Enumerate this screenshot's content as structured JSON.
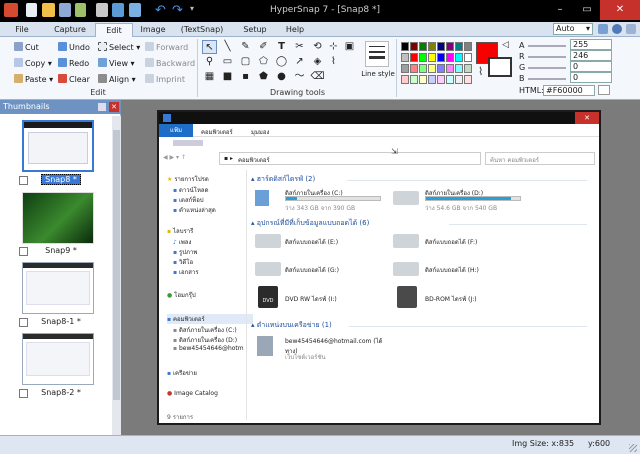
{
  "window": {
    "title": "HyperSnap 7 - [Snap8 *]",
    "minimize": "–",
    "maximize": "▭",
    "close": "✕"
  },
  "tabs": [
    {
      "label": "File",
      "active": false
    },
    {
      "label": "Capture",
      "active": false
    },
    {
      "label": "Edit",
      "active": true
    },
    {
      "label": "Image",
      "active": false
    },
    {
      "label": "(TextSnap)",
      "active": false
    },
    {
      "label": "Setup",
      "active": false
    },
    {
      "label": "Help",
      "active": false
    }
  ],
  "zoom": {
    "value": "Auto",
    "arrow": "▾"
  },
  "ribbon": {
    "edit_group": "Edit",
    "drawing_group": "Drawing tools",
    "buttons": {
      "cut": "Cut",
      "copy": "Copy",
      "paste": "Paste",
      "undo": "Undo",
      "redo": "Redo",
      "clear": "Clear",
      "select": "Select",
      "view": "View",
      "align": "Align",
      "forward": "Forward",
      "backward": "Backward",
      "imprint": "Imprint"
    },
    "line_style": "Line style",
    "color": {
      "a_label": "A",
      "r_label": "R",
      "g_label": "G",
      "b_label": "B",
      "a": "255",
      "r": "246",
      "g": "0",
      "b": "0",
      "html_label": "HTML:",
      "html": "#F60000",
      "current_color": "#F60000"
    },
    "palette": [
      "#000000",
      "#800000",
      "#008000",
      "#808000",
      "#000080",
      "#800080",
      "#008080",
      "#808080",
      "#c0c0c0",
      "#ff0000",
      "#00ff00",
      "#ffff00",
      "#0000ff",
      "#ff00ff",
      "#00ffff",
      "#ffffff",
      "#a0a0a4",
      "#ff8080",
      "#80ff80",
      "#ffff80",
      "#8080ff",
      "#ff80ff",
      "#80ffff",
      "#c0dcc0",
      "#ffcccc",
      "#ccffcc",
      "#ffffcc",
      "#ccccff",
      "#ffccff",
      "#ccffff",
      "#f0f0f0",
      "#ffe0e0"
    ]
  },
  "thumbnails": {
    "header": "Thumbnails",
    "items": [
      {
        "label": "Snap8 *",
        "selected": true
      },
      {
        "label": "Snap9 *",
        "selected": false
      },
      {
        "label": "Snap8-1 *",
        "selected": false
      },
      {
        "label": "Snap8-2 *",
        "selected": false
      }
    ]
  },
  "explorer": {
    "ribbon_tabs": [
      "แฟ้ม",
      "คอมพิวเตอร์",
      "มุมมอง"
    ],
    "breadcrumb": "คอมพิวเตอร์",
    "search_placeholder": "ค้นหา คอมพิวเตอร์",
    "nav": [
      {
        "label": "รายการโปรด"
      },
      {
        "label": "ดาวน์โหลด"
      },
      {
        "label": "เดสก์ท็อป"
      },
      {
        "label": "ตำแหน่งล่าสุด"
      },
      {
        "label": "ไลบรารี"
      },
      {
        "label": "เพลง"
      },
      {
        "label": "รูปภาพ"
      },
      {
        "label": "วิดีโอ"
      },
      {
        "label": "เอกสาร"
      },
      {
        "label": "โฮมกรุ๊ป"
      },
      {
        "label": "คอมพิวเตอร์"
      },
      {
        "label": "ดิสก์ภายในเครื่อง (C:)"
      },
      {
        "label": "ดิสก์ภายในเครื่อง (D:)"
      },
      {
        "label": "bew45454646@hotm"
      },
      {
        "label": "เครือข่าย"
      },
      {
        "label": "Image Catalog"
      }
    ],
    "sections": {
      "hdd": "ฮาร์ดดิสก์ไดรฟ์ (2)",
      "removable": "อุปกรณ์ที่มีที่เก็บข้อมูลแบบถอดได้ (6)",
      "network": "ตำแหน่งบนเครือข่าย (1)"
    },
    "drives": [
      {
        "name": "ดิสก์ภายในเครื่อง (C:)",
        "info": "ว่าง 343 GB จาก 390 GB",
        "used": 0.12
      },
      {
        "name": "ดิสก์ภายในเครื่อง (D:)",
        "info": "ว่าง 54.6 GB จาก 540 GB",
        "used": 0.9
      }
    ],
    "removable": [
      "ดิสก์แบบถอดได้ (E:)",
      "ดิสก์แบบถอดได้ (F:)",
      "ดิสก์แบบถอดได้ (G:)",
      "ดิสก์แบบถอดได้ (H:)",
      "DVD RW ไดรฟ์ (I:)",
      "BD-ROM ไดรฟ์ (J:)"
    ],
    "dvd_badge": "DVD",
    "network_item": {
      "name": "bew45454646@hotmail.com (ได้ทาง)",
      "sub": "เว็บไซต์เวอร์ชัน"
    },
    "item_count": "9 รายการ"
  },
  "status": {
    "img_size": "Img Size:  x:835",
    "y": "y:600"
  }
}
